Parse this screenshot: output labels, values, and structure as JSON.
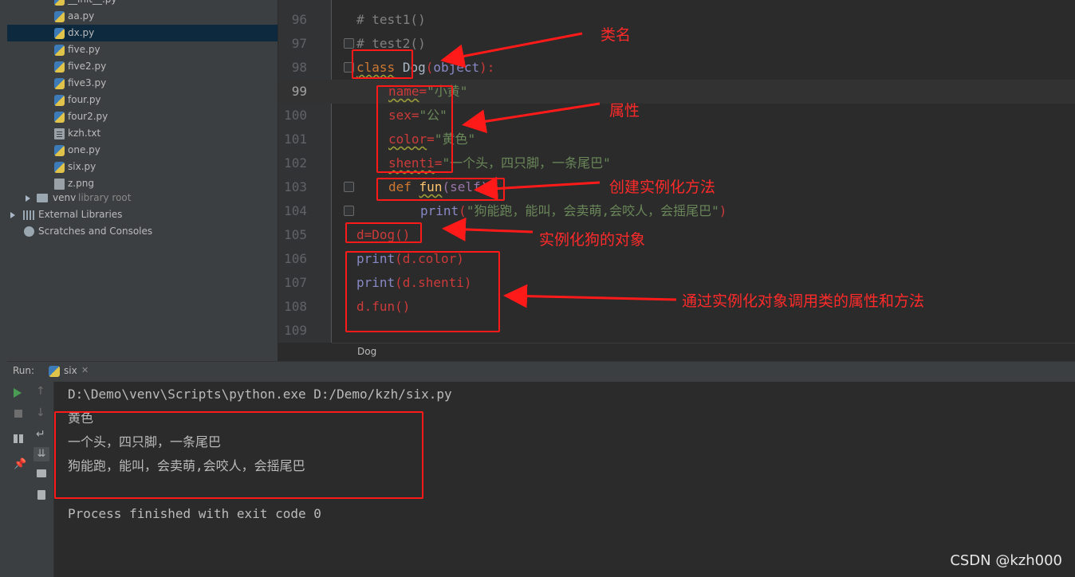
{
  "tree": {
    "items": [
      {
        "label": "__init__.py",
        "icon": "python-file-icon",
        "selected": false
      },
      {
        "label": "aa.py",
        "icon": "python-file-icon",
        "selected": false
      },
      {
        "label": "dx.py",
        "icon": "python-file-icon",
        "selected": true
      },
      {
        "label": "five.py",
        "icon": "python-file-icon",
        "selected": false
      },
      {
        "label": "five2.py",
        "icon": "python-file-icon",
        "selected": false
      },
      {
        "label": "five3.py",
        "icon": "python-file-icon",
        "selected": false
      },
      {
        "label": "four.py",
        "icon": "python-file-icon",
        "selected": false
      },
      {
        "label": "four2.py",
        "icon": "python-file-icon",
        "selected": false
      },
      {
        "label": "kzh.txt",
        "icon": "text-file-icon",
        "selected": false
      },
      {
        "label": "one.py",
        "icon": "python-file-icon",
        "selected": false
      },
      {
        "label": "six.py",
        "icon": "python-file-icon",
        "selected": false
      },
      {
        "label": "z.png",
        "icon": "image-file-icon",
        "selected": false
      }
    ],
    "venv": {
      "name": "venv",
      "note": "library root"
    },
    "external_libraries": "External Libraries",
    "scratches": "Scratches and Consoles"
  },
  "editor": {
    "line_numbers": [
      "96",
      "97",
      "98",
      "99",
      "100",
      "101",
      "102",
      "103",
      "104",
      "105",
      "106",
      "107",
      "108",
      "109"
    ],
    "current_line": "99",
    "code": {
      "l96": "# test1()",
      "l97": "# test2()",
      "l98_kw": "class",
      "l98_name": "Dog",
      "l98_paren_open": "(",
      "l98_base": "object",
      "l98_paren_close": "):",
      "l99_var": "name",
      "l99_eq": "=",
      "l99_str": "\"小黄\"",
      "l100_var": "sex",
      "l100_eq": "=",
      "l100_str": "\"公\"",
      "l101_var": "color",
      "l101_eq": "=",
      "l101_str": "\"黄色\"",
      "l102_var": "shenti",
      "l102_eq": "=",
      "l102_str": "\"一个头，四只脚，一条尾巴\"",
      "l103_kw": "def",
      "l103_fn": "fun",
      "l103_params": "(self):",
      "l104_fn": "print",
      "l104_open": "(",
      "l104_str": "\"狗能跑，能叫，会卖萌,会咬人，会摇尾巴\"",
      "l104_close": ")",
      "l105": "d=Dog()",
      "l106_fn": "print",
      "l106_rest": "(d.color)",
      "l107_fn": "print",
      "l107_rest": "(d.shenti)",
      "l108": "d.fun()"
    },
    "breadcrumb": "Dog"
  },
  "run": {
    "label": "Run:",
    "tab": "six",
    "console_lines": [
      "D:\\Demo\\venv\\Scripts\\python.exe D:/Demo/kzh/six.py",
      "黄色",
      "一个头，四只脚，一条尾巴",
      "狗能跑，能叫，会卖萌,会咬人，会摇尾巴",
      "",
      "Process finished with exit code 0"
    ]
  },
  "annotations": {
    "class_name": "类名",
    "attributes": "属性",
    "create_method": "创建实例化方法",
    "instantiate": "实例化狗的对象",
    "call": "通过实例化对象调用类的属性和方法"
  },
  "watermark": "CSDN @kzh000",
  "colors": {
    "annotation": "#ff1a1a",
    "keyword": "#cc7832",
    "string": "#6a8759",
    "function": "#ffc66d"
  }
}
